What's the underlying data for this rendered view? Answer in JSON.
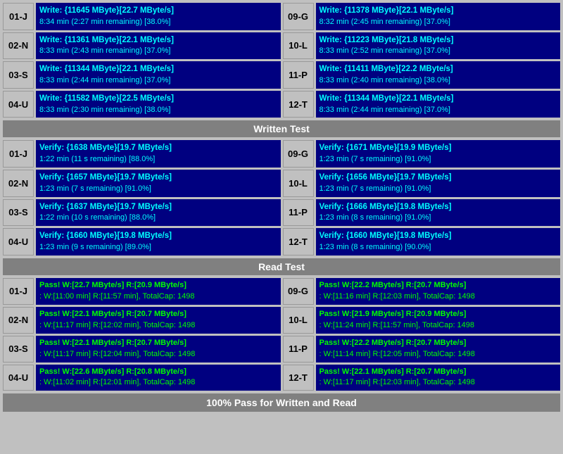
{
  "sections": {
    "write_label": "Written Test",
    "read_label": "Read Test",
    "bottom_status": "100% Pass for Written and Read"
  },
  "write_rows": [
    {
      "left_id": "01-J",
      "left_line1": "Write: {11645 MByte}[22.7 MByte/s]",
      "left_line2": "8:34 min (2:27 min remaining)  [38.0%]",
      "right_id": "09-G",
      "right_line1": "Write: {11378 MByte}[22.1 MByte/s]",
      "right_line2": "8:32 min (2:45 min remaining)  [37.0%]"
    },
    {
      "left_id": "02-N",
      "left_line1": "Write: {11361 MByte}[22.1 MByte/s]",
      "left_line2": "8:33 min (2:43 min remaining)  [37.0%]",
      "right_id": "10-L",
      "right_line1": "Write: {11223 MByte}[21.8 MByte/s]",
      "right_line2": "8:33 min (2:52 min remaining)  [37.0%]"
    },
    {
      "left_id": "03-S",
      "left_line1": "Write: {11344 MByte}[22.1 MByte/s]",
      "left_line2": "8:33 min (2:44 min remaining)  [37.0%]",
      "right_id": "11-P",
      "right_line1": "Write: {11411 MByte}[22.2 MByte/s]",
      "right_line2": "8:33 min (2:40 min remaining)  [38.0%]"
    },
    {
      "left_id": "04-U",
      "left_line1": "Write: {11582 MByte}[22.5 MByte/s]",
      "left_line2": "8:33 min (2:30 min remaining)  [38.0%]",
      "right_id": "12-T",
      "right_line1": "Write: {11344 MByte}[22.1 MByte/s]",
      "right_line2": "8:33 min (2:44 min remaining)  [37.0%]"
    }
  ],
  "verify_rows": [
    {
      "left_id": "01-J",
      "left_line1": "Verify: {1638 MByte}[19.7 MByte/s]",
      "left_line2": "1:22 min (11 s remaining)  [88.0%]",
      "right_id": "09-G",
      "right_line1": "Verify: {1671 MByte}[19.9 MByte/s]",
      "right_line2": "1:23 min (7 s remaining)  [91.0%]"
    },
    {
      "left_id": "02-N",
      "left_line1": "Verify: {1657 MByte}[19.7 MByte/s]",
      "left_line2": "1:23 min (7 s remaining)  [91.0%]",
      "right_id": "10-L",
      "right_line1": "Verify: {1656 MByte}[19.7 MByte/s]",
      "right_line2": "1:23 min (7 s remaining)  [91.0%]"
    },
    {
      "left_id": "03-S",
      "left_line1": "Verify: {1637 MByte}[19.7 MByte/s]",
      "left_line2": "1:22 min (10 s remaining)  [88.0%]",
      "right_id": "11-P",
      "right_line1": "Verify: {1666 MByte}[19.8 MByte/s]",
      "right_line2": "1:23 min (8 s remaining)  [91.0%]"
    },
    {
      "left_id": "04-U",
      "left_line1": "Verify: {1660 MByte}[19.8 MByte/s]",
      "left_line2": "1:23 min (9 s remaining)  [89.0%]",
      "right_id": "12-T",
      "right_line1": "Verify: {1660 MByte}[19.8 MByte/s]",
      "right_line2": "1:23 min (8 s remaining)  [90.0%]"
    }
  ],
  "pass_rows": [
    {
      "left_id": "01-J",
      "left_line1": "Pass! W:[22.7 MByte/s] R:[20.9 MByte/s]",
      "left_line2": ": W:[11:00 min] R:[11:57 min], TotalCap: 1498",
      "right_id": "09-G",
      "right_line1": "Pass! W:[22.2 MByte/s] R:[20.7 MByte/s]",
      "right_line2": ": W:[11:16 min] R:[12:03 min], TotalCap: 1498"
    },
    {
      "left_id": "02-N",
      "left_line1": "Pass! W:[22.1 MByte/s] R:[20.7 MByte/s]",
      "left_line2": ": W:[11:17 min] R:[12:02 min], TotalCap: 1498",
      "right_id": "10-L",
      "right_line1": "Pass! W:[21.9 MByte/s] R:[20.9 MByte/s]",
      "right_line2": ": W:[11:24 min] R:[11:57 min], TotalCap: 1498"
    },
    {
      "left_id": "03-S",
      "left_line1": "Pass! W:[22.1 MByte/s] R:[20.7 MByte/s]",
      "left_line2": ": W:[11:17 min] R:[12:04 min], TotalCap: 1498",
      "right_id": "11-P",
      "right_line1": "Pass! W:[22.2 MByte/s] R:[20.7 MByte/s]",
      "right_line2": ": W:[11:14 min] R:[12:05 min], TotalCap: 1498"
    },
    {
      "left_id": "04-U",
      "left_line1": "Pass! W:[22.6 MByte/s] R:[20.8 MByte/s]",
      "left_line2": ": W:[11:02 min] R:[12:01 min], TotalCap: 1498",
      "right_id": "12-T",
      "right_line1": "Pass! W:[22.1 MByte/s] R:[20.7 MByte/s]",
      "right_line2": ": W:[11:17 min] R:[12:03 min], TotalCap: 1498"
    }
  ]
}
